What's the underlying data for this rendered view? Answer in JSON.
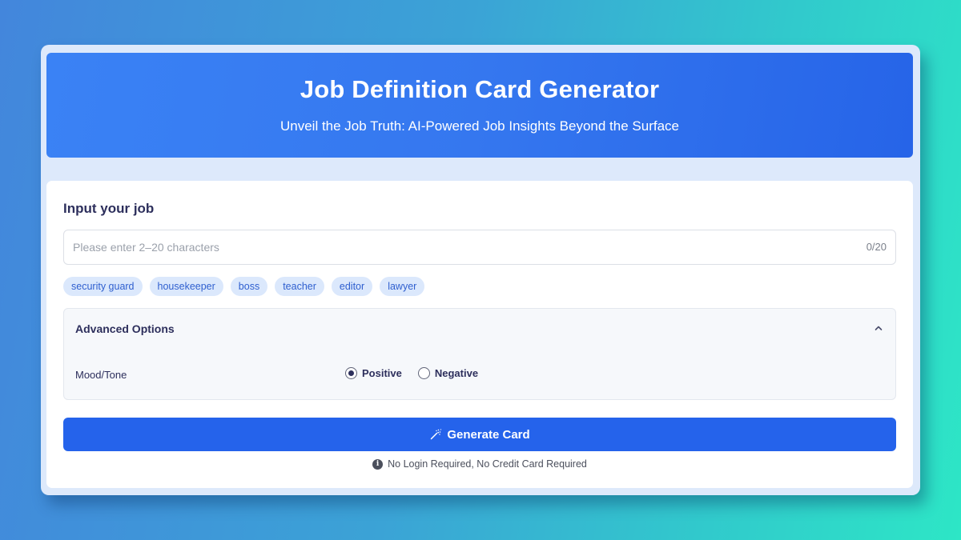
{
  "header": {
    "title": "Job Definition Card Generator",
    "subtitle": "Unveil the Job Truth: AI-Powered Job Insights Beyond the Surface"
  },
  "form": {
    "section_label": "Input your job",
    "job_input": {
      "value": "",
      "placeholder": "Please enter 2–20 characters",
      "char_count": "0/20"
    },
    "suggestions": [
      {
        "label": "security guard"
      },
      {
        "label": "housekeeper"
      },
      {
        "label": "boss"
      },
      {
        "label": "teacher"
      },
      {
        "label": "editor"
      },
      {
        "label": "lawyer"
      }
    ],
    "advanced_options": {
      "title": "Advanced Options",
      "expanded": true,
      "toggle_icon": "chevron-up-icon",
      "mood_label": "Mood/Tone",
      "mood_options": [
        {
          "label": "Positive",
          "checked": true
        },
        {
          "label": "Negative",
          "checked": false
        }
      ]
    },
    "generate_button": {
      "label": "Generate Card",
      "icon": "magic-wand-icon"
    },
    "footnote": {
      "icon": "info-icon",
      "text": "No Login Required, No Credit Card Required"
    }
  },
  "colors": {
    "primary": "#2563eb",
    "header_gradient_start": "#3a82f5",
    "header_gradient_end": "#2664e8",
    "chip_bg": "#dbe8fc",
    "chip_text": "#2f5fcf",
    "heading_text": "#2d2f5c"
  }
}
